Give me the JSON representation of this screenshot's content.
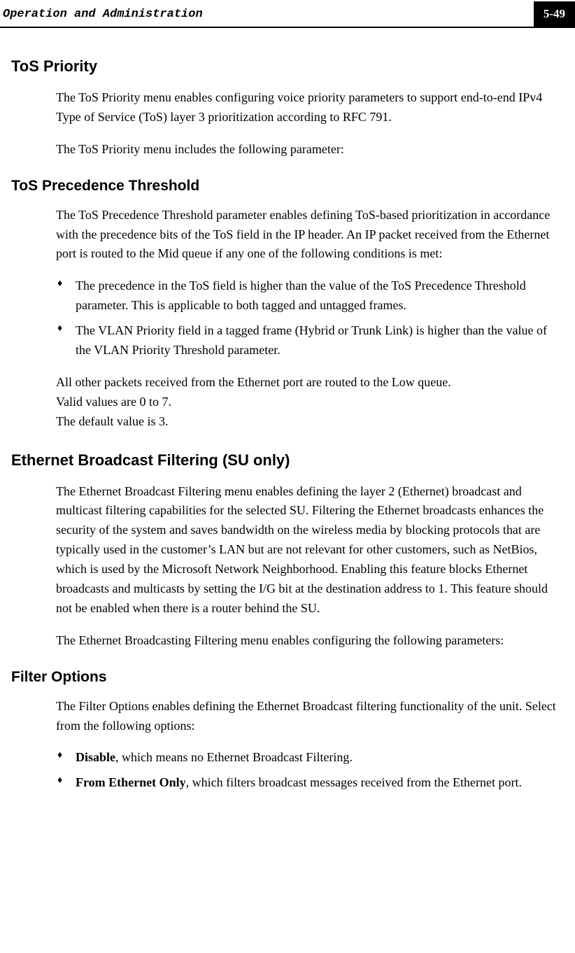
{
  "header": {
    "title": "Operation and Administration",
    "page_number": "5-49"
  },
  "sections": {
    "tos_priority": {
      "heading": "ToS Priority",
      "p1": "The ToS Priority menu enables configuring voice priority parameters to support end-to-end IPv4 Type of Service (ToS) layer 3 prioritization according to RFC 791.",
      "p2": "The ToS Priority menu includes the following parameter:"
    },
    "tos_precedence": {
      "heading": "ToS Precedence Threshold",
      "p1": "The ToS Precedence Threshold parameter enables defining ToS-based prioritization in accordance with the precedence bits of the ToS field in the IP header. An IP packet received from the Ethernet port is routed to the Mid queue if any one of the following conditions is met:",
      "b1": "The precedence in the ToS field is higher than the value of the ToS Precedence Threshold parameter. This is applicable to both tagged and untagged frames.",
      "b2": " The VLAN Priority field in a tagged frame (Hybrid or Trunk Link) is higher than the value of the VLAN Priority Threshold parameter.",
      "p2a": "All other packets received from the Ethernet port are routed to the Low queue.",
      "p2b": "Valid values are 0 to 7.",
      "p2c": "The default value is 3."
    },
    "ebf": {
      "heading": "Ethernet Broadcast Filtering (SU only)",
      "p1": "The Ethernet Broadcast Filtering menu enables defining the layer 2 (Ethernet) broadcast and multicast filtering capabilities for the selected SU. Filtering the Ethernet broadcasts enhances the security of the system and saves bandwidth on the wireless media by blocking protocols that are typically used in the customer’s LAN but are not relevant for other customers, such as NetBios, which is used by the Microsoft Network Neighborhood. Enabling this feature blocks Ethernet broadcasts and multicasts by setting the I/G bit at the destination address to 1. This feature should not be enabled when there is a router behind the SU.",
      "p2": "The Ethernet Broadcasting Filtering menu enables configuring the following parameters:"
    },
    "filter_options": {
      "heading": "Filter Options",
      "p1": "The Filter Options enables defining the Ethernet Broadcast filtering functionality of the unit. Select from the following options:",
      "b1_bold": "Disable",
      "b1_rest": ", which means no Ethernet Broadcast Filtering.",
      "b2_bold": "From Ethernet Only",
      "b2_rest": ", which filters broadcast messages received from the Ethernet port."
    }
  }
}
